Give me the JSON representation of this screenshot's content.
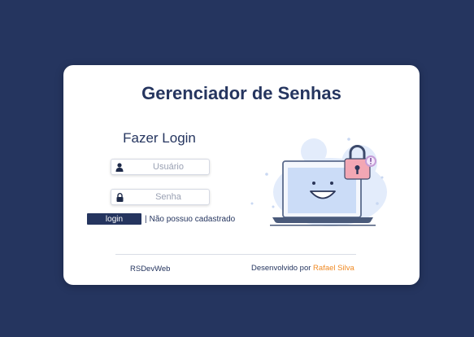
{
  "header": {
    "title": "Gerenciador de Senhas"
  },
  "login": {
    "title": "Fazer Login",
    "username_placeholder": "Usuário",
    "password_placeholder": "Senha",
    "login_button": "login",
    "separator": "|",
    "register_link": "Não possuo cadastrado"
  },
  "footer": {
    "brand": "RSDevWeb",
    "credit_prefix": "Desenvolvido por",
    "author": "Rafael Silva"
  },
  "icons": {
    "user": "user-icon",
    "lock": "lock-icon",
    "illustration": "laptop-padlock-illustration"
  },
  "colors": {
    "background": "#25355f",
    "card": "#ffffff",
    "primary": "#25355f",
    "accent": "#f08a24",
    "padlock": "#f2a7b4"
  }
}
